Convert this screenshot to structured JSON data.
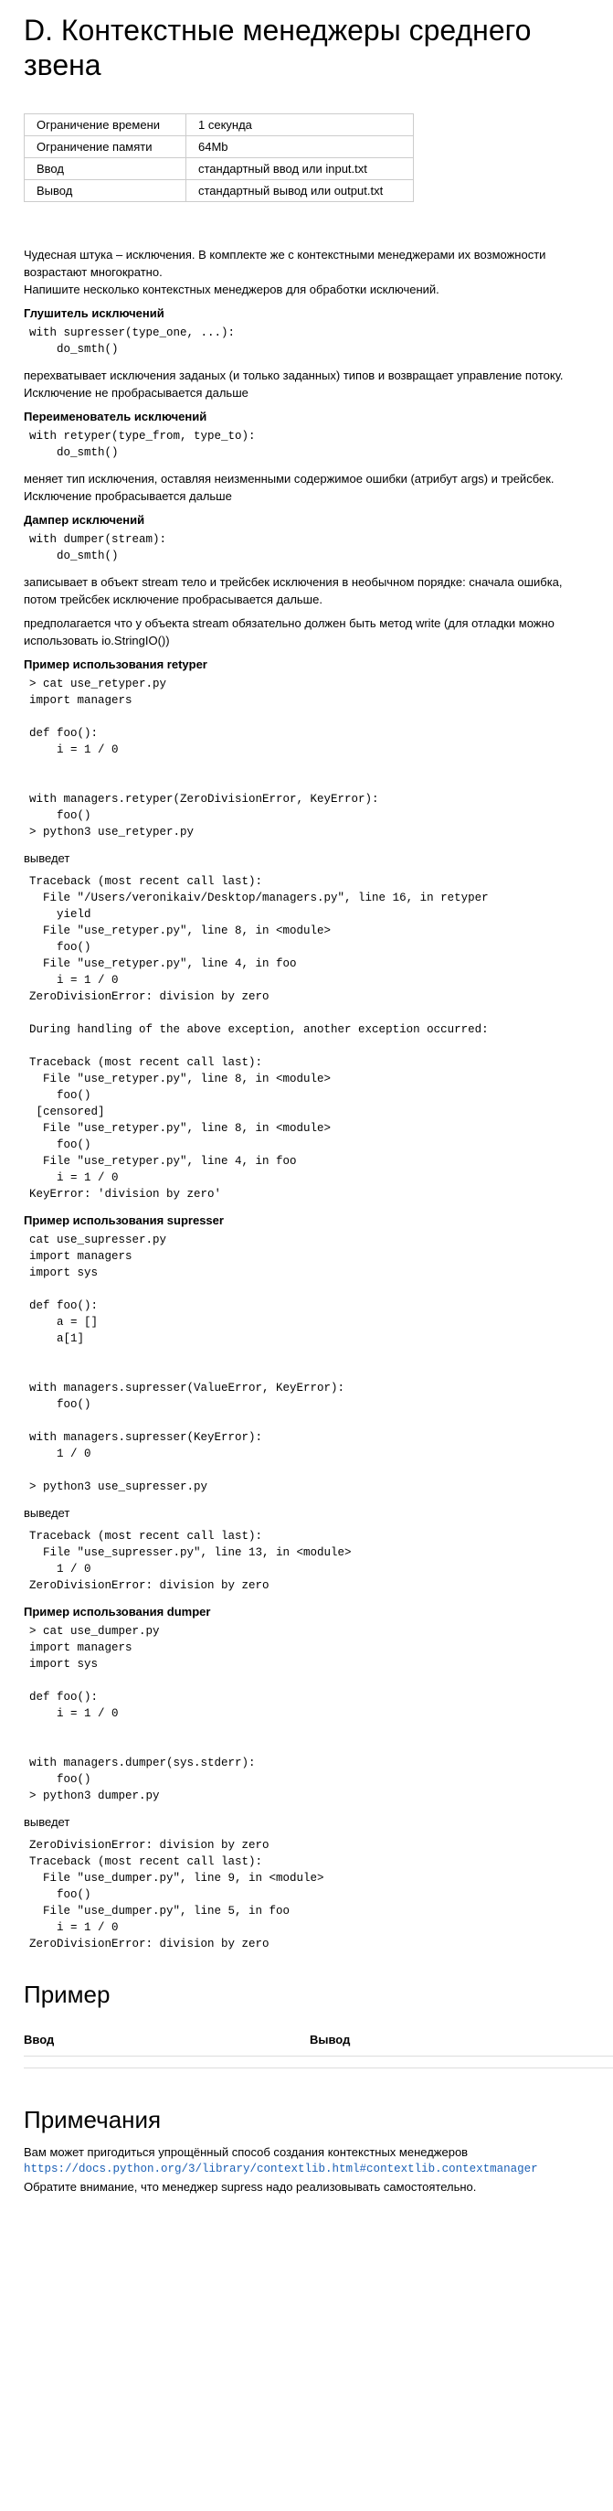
{
  "title": "D. Контекстные менеджеры среднего звена",
  "limits": [
    {
      "k": "Ограничение времени",
      "v": "1 секунда"
    },
    {
      "k": "Ограничение памяти",
      "v": "64Mb"
    },
    {
      "k": "Ввод",
      "v": "стандартный ввод или input.txt"
    },
    {
      "k": "Вывод",
      "v": "стандартный вывод или output.txt"
    }
  ],
  "intro1": "Чудесная штука – исключения. В комплекте же с контекстными менеджерами их возможности возрастают многократно.",
  "intro2": "Напишите несколько контекстных менеджеров для обработки исключений.",
  "supresser": {
    "heading": "Глушитель исключений",
    "code": "with supresser(type_one, ...):\n    do_smth()",
    "desc": "перехватывает исключения заданых (и только заданных) типов и возвращает управление потоку. Исключение не пробрасывается дальше"
  },
  "retyper": {
    "heading": "Переименователь исключений",
    "code": "with retyper(type_from, type_to):\n    do_smth()",
    "desc": "меняет тип исключения, оставляя неизменными содержимое ошибки (атрибут args) и трейсбек. Исключение пробрасывается дальше"
  },
  "dumper": {
    "heading": "Дампер исключений",
    "code": "with dumper(stream):\n    do_smth()",
    "desc1": "записывает в объект stream тело и трейсбек исключения в необычном порядке: сначала ошибка, потом трейсбек исключение пробрасывается дальше.",
    "desc2": "предполагается что у объекта stream обязательно должен быть метод write (для отладки можно использовать io.StringIO())"
  },
  "ex_retyper": {
    "heading": "Пример использования retyper",
    "code": "> cat use_retyper.py\nimport managers\n\ndef foo():\n    i = 1 / 0\n\n\nwith managers.retyper(ZeroDivisionError, KeyError):\n    foo()\n> python3 use_retyper.py",
    "outputs": "выведет",
    "output": "Traceback (most recent call last):\n  File \"/Users/veronikaiv/Desktop/managers.py\", line 16, in retyper\n    yield\n  File \"use_retyper.py\", line 8, in <module>\n    foo()\n  File \"use_retyper.py\", line 4, in foo\n    i = 1 / 0\nZeroDivisionError: division by zero\n\nDuring handling of the above exception, another exception occurred:\n\nTraceback (most recent call last):\n  File \"use_retyper.py\", line 8, in <module>\n    foo()\n [censored]\n  File \"use_retyper.py\", line 8, in <module>\n    foo()\n  File \"use_retyper.py\", line 4, in foo\n    i = 1 / 0\nKeyError: 'division by zero'"
  },
  "ex_supresser": {
    "heading": "Пример использования supresser",
    "code": "cat use_supresser.py\nimport managers\nimport sys\n\ndef foo():\n    a = []\n    a[1]\n\n\nwith managers.supresser(ValueError, KeyError):\n    foo()\n\nwith managers.supresser(KeyError):\n    1 / 0\n\n> python3 use_supresser.py",
    "outputs": "выведет",
    "output": "Traceback (most recent call last):\n  File \"use_supresser.py\", line 13, in <module>\n    1 / 0\nZeroDivisionError: division by zero"
  },
  "ex_dumper": {
    "heading": "Пример использования dumper",
    "code": "> cat use_dumper.py\nimport managers\nimport sys\n\ndef foo():\n    i = 1 / 0\n\n\nwith managers.dumper(sys.stderr):\n    foo()\n> python3 dumper.py",
    "outputs": "выведет",
    "output": "ZeroDivisionError: division by zero\nTraceback (most recent call last):\n  File \"use_dumper.py\", line 9, in <module>\n    foo()\n  File \"use_dumper.py\", line 5, in foo\n    i = 1 / 0\nZeroDivisionError: division by zero"
  },
  "example": {
    "heading": "Пример",
    "input_label": "Ввод",
    "output_label": "Вывод"
  },
  "notes": {
    "heading": "Примечания",
    "text1": "Вам может пригодиться упрощённый способ создания контекстных менеджеров",
    "link": "https://docs.python.org/3/library/contextlib.html#contextlib.contextmanager",
    "text2": "Обратите внимание, что менеджер supress надо реализовывать самостоятельно."
  },
  "link_color": "#1a5fb4"
}
